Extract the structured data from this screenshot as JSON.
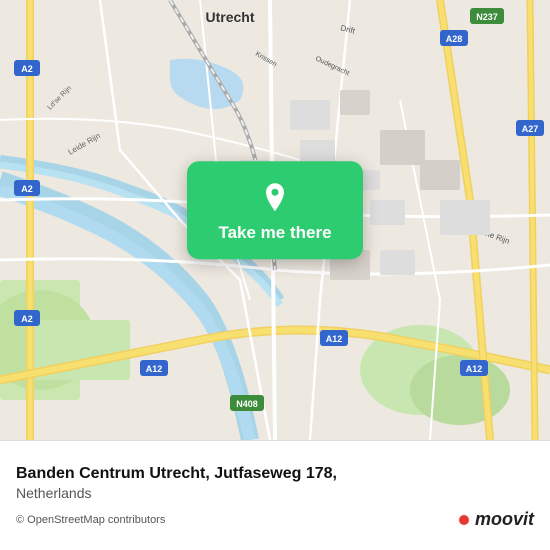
{
  "map": {
    "alt": "Map of Utrecht, Netherlands"
  },
  "popup": {
    "button_label": "Take me there",
    "pin_icon": "location-pin"
  },
  "bottom_bar": {
    "title": "Banden Centrum Utrecht, Jutfaseweg 178,",
    "country": "Netherlands",
    "osm_credit": "© OpenStreetMap contributors",
    "moovit_label": "moovit"
  }
}
